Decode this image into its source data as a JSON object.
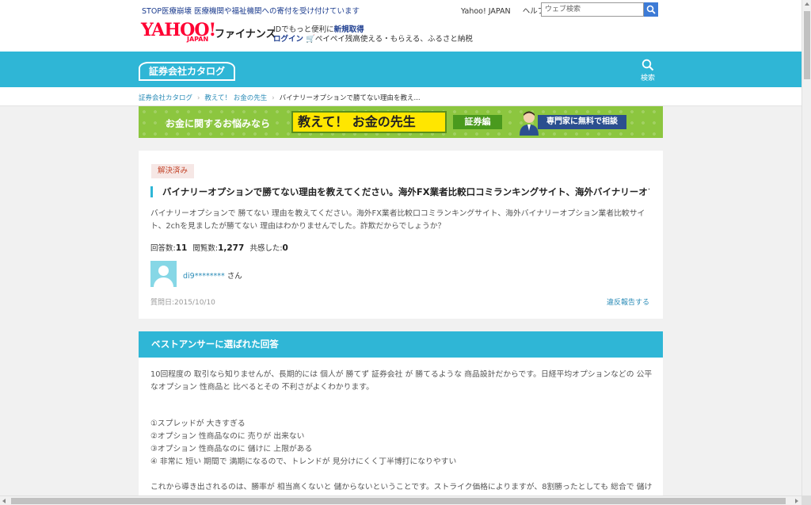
{
  "header": {
    "promo": "STOP医療崩壊 医療機関や福祉機関への寄付を受け付けています",
    "links": [
      "Yahoo! JAPAN",
      "ヘルプ"
    ],
    "search_placeholder": "ウェブ検索",
    "logo_text": "YAHOO!",
    "logo_sub": "JAPAN",
    "service_name": "ファイナンス",
    "id_prefix": "IDでもっと便利に",
    "id_register": "新規取得",
    "login": "ログイン",
    "paypay_text": "ペイペイ残高使える・もらえる、ふるさと納税"
  },
  "catalog": {
    "logo": "証券会社カタログ",
    "search_label": "検索"
  },
  "breadcrumb": [
    "証券会社カタログ",
    "教えて！ お金の先生",
    "バイナリーオプションで勝てない理由を教え..."
  ],
  "banner": {
    "question": "お金に関するお悩みなら",
    "main": "教えて！ お金の先生",
    "tag": "証券編",
    "cta": "専門家に無料で相談"
  },
  "question": {
    "status": "解決済み",
    "title": "バイナリーオプションで勝てない理由を教えてください。海外FX業者比較口コミランキングサイト、海外バイナリーオプ…",
    "body": "バイナリーオプションで 勝てない 理由を教えてください。海外FX業者比較口コミランキングサイト、海外バイナリーオプション業者比較サイト、2chを見ましたが勝てない 理由はわかりませんでした。詐欺だからでしょうか？",
    "answers_label": "回答数:",
    "answers": "11",
    "views_label": "閲覧数:",
    "views": "1,277",
    "empathy_label": "共感した:",
    "empathy": "0",
    "user_id": "di9********",
    "user_suffix": "さん",
    "date": "質問日:2015/10/10",
    "report": "違反報告する"
  },
  "best_answer": {
    "heading": "ベストアンサーに選ばれた回答",
    "p1": "10回程度の 取引なら知りませんが、長期的には 個人が 勝てず 証券会社 が 勝てるような 商品設計だからです。日経平均オプションなどの 公平なオプション 性商品と 比べるとその 不利さがよくわかります。",
    "items": [
      "①スプレッドが 大きすぎる",
      "②オプション 性商品なのに 売りが 出来ない",
      "③オプション 性商品なのに 儲けに 上限がある",
      "④ 非常に 短い 期間で 満期になるので、トレンドが 見分けにくく丁半博打になりやすい"
    ],
    "p2": "これから導き出されるのは、勝率が 相当高くないと 儲からないということです。ストライク価格によりますが、8割勝ったとしても 総合で 儲け"
  },
  "colors": {
    "accent": "#2fb6d6",
    "link": "#2d8db8",
    "banner_green": "#8cc63f",
    "badge_text": "#c4452a"
  }
}
